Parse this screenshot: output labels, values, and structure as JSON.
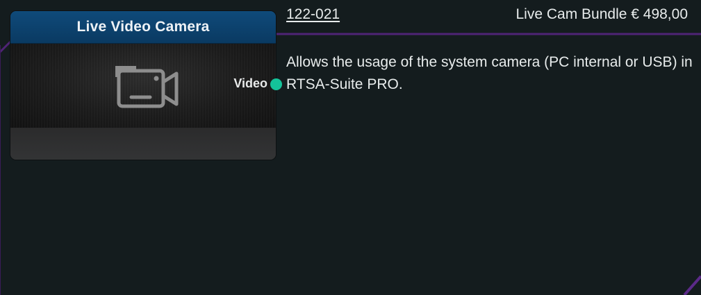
{
  "block": {
    "title": "Live Video Camera",
    "port_label": "Video",
    "icon": "video-camera-icon",
    "port_color": "#14c39a",
    "header_color": "#0f4a7a"
  },
  "product": {
    "article_number": "122-021",
    "price": "Live Cam Bundle € 498,00",
    "description": "Allows the usage of the system camera (PC internal or USB) in RTSA-Suite PRO."
  },
  "frame_color": "#5a2a86"
}
